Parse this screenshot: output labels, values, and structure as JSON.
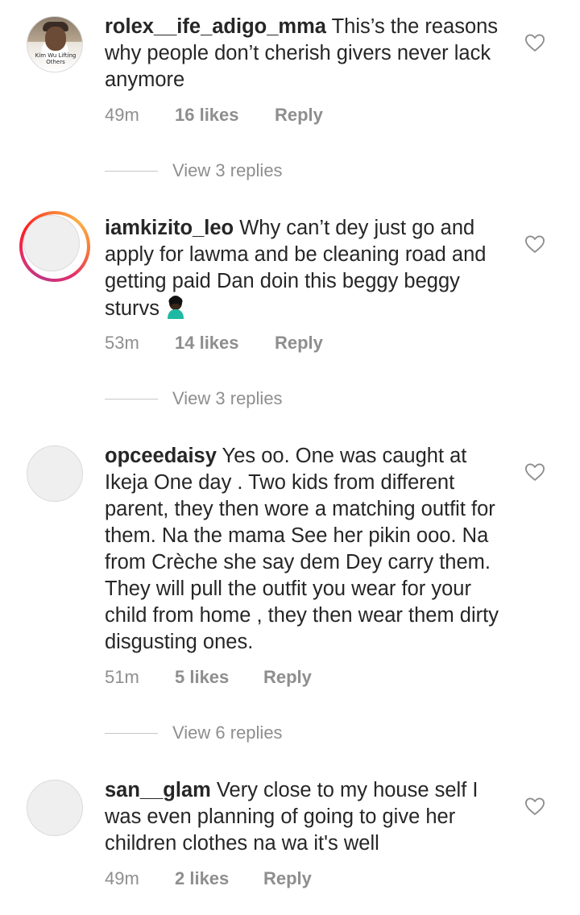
{
  "comments": [
    {
      "username": "rolex__ife_adigo_mma",
      "text": " This’s the reasons why people don’t cherish givers never lack anymore",
      "time": "49m",
      "likes": "16 likes",
      "reply": "Reply",
      "view_replies": "View 3 replies",
      "avatar_caption": "Kim Wu Lifting Others"
    },
    {
      "username": "iamkizito_leo",
      "text": " Why can’t dey just go and apply for lawma and be cleaning road and getting paid Dan doin this beggy beggy sturvs ",
      "emoji": "person-facepalming",
      "time": "53m",
      "likes": "14 likes",
      "reply": "Reply",
      "view_replies": "View 3 replies"
    },
    {
      "username": "opceedaisy",
      "text": " Yes oo. One was caught at Ikeja One day . Two kids from different parent, they then wore a matching outfit for them. Na the mama See her pikin ooo. Na from Crèche she say dem Dey carry them. They will pull the outfit you wear for your child from home , they then wear them dirty disgusting ones.",
      "time": "51m",
      "likes": "5 likes",
      "reply": "Reply",
      "view_replies": "View 6 replies"
    },
    {
      "username": "san__glam",
      "text": " Very close to my house self I was even planning of going to give her children clothes na wa it's well",
      "time": "49m",
      "likes": "2 likes",
      "reply": "Reply"
    }
  ],
  "colors": {
    "text": "#262626",
    "meta": "#8e8e8e",
    "divider": "#c7c7c7",
    "story_ring": [
      "#c13584",
      "#e1306c",
      "#fd1d1d",
      "#f77737",
      "#fcaf45"
    ]
  },
  "icons": {
    "like": "heart-outline-icon"
  }
}
